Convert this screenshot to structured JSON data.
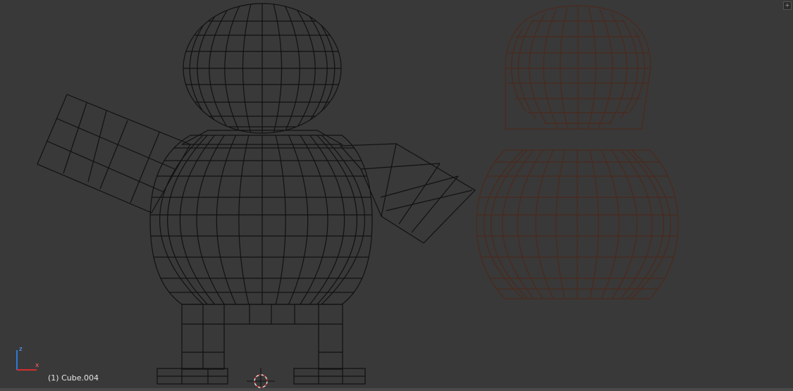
{
  "viewport": {
    "object_label": "(1) Cube.004",
    "view_axes": {
      "up_axis": "z",
      "right_axis": "x"
    },
    "corner_widget_icon": "area-split-icon"
  },
  "scene": {
    "objects": [
      {
        "name": "character-mesh",
        "render": "wireframe",
        "color": "#111111"
      },
      {
        "name": "head-mesh",
        "render": "wireframe",
        "color": "#4a2a1e"
      },
      {
        "name": "body-mesh",
        "render": "wireframe",
        "color": "#4a2a1e"
      }
    ],
    "cursor_icon": "3d-cursor-icon"
  },
  "colors": {
    "background": "#393939",
    "axis_x": "#d42d2d",
    "axis_z": "#2e7ad6"
  }
}
